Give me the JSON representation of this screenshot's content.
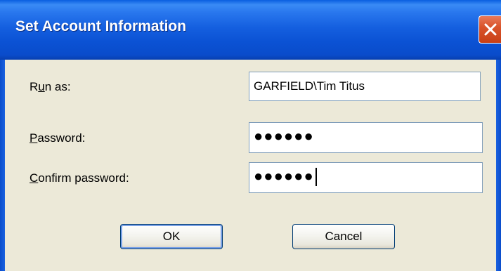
{
  "window": {
    "title": "Set Account Information"
  },
  "form": {
    "run_as": {
      "label_mnemonic": "u",
      "label_before": "R",
      "label_after": "n as:",
      "value": "GARFIELD\\Tim Titus"
    },
    "password": {
      "label_mnemonic": "P",
      "label_after": "assword:",
      "value": "●●●●●●"
    },
    "confirm_password": {
      "label_mnemonic": "C",
      "label_after": "onfirm password:",
      "value": "●●●●●●"
    }
  },
  "buttons": {
    "ok_label": "OK",
    "cancel_label": "Cancel"
  },
  "colors": {
    "titlebar": "#0a4ccb",
    "dialog_bg": "#ece9d8",
    "close_button": "#d9542b"
  },
  "icons": {
    "close": "close-icon"
  }
}
